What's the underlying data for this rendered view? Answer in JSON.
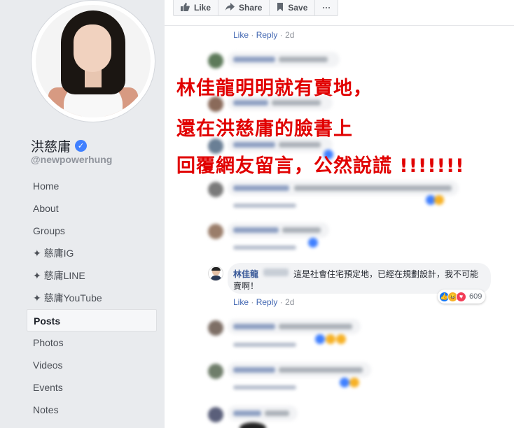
{
  "sidebar": {
    "page_name": "洪慈庸",
    "handle": "@newpowerhung",
    "items": [
      {
        "label": "Home",
        "active": false
      },
      {
        "label": "About",
        "active": false
      },
      {
        "label": "Groups",
        "active": false
      },
      {
        "label": "✦ 慈庸IG",
        "active": false
      },
      {
        "label": "✦ 慈庸LINE",
        "active": false
      },
      {
        "label": "✦ 慈庸YouTube",
        "active": false
      },
      {
        "label": "Posts",
        "active": true
      },
      {
        "label": "Photos",
        "active": false
      },
      {
        "label": "Videos",
        "active": false
      },
      {
        "label": "Events",
        "active": false
      },
      {
        "label": "Notes",
        "active": false
      }
    ]
  },
  "actions": {
    "like": "Like",
    "share": "Share",
    "save": "Save",
    "more": "···"
  },
  "comment_meta": {
    "like": "Like",
    "sep": "·",
    "reply": "Reply",
    "time": "2d"
  },
  "overlay": {
    "line1": "林佳龍明明就有賣地，",
    "line2": "還在洪慈庸的臉書上",
    "line3": "回覆網友留言，公然說謊 !!!!!!!"
  },
  "featured_comment": {
    "name": "林佳龍",
    "text": "這是社會住宅預定地，已經在規劃設計，我不可能賣啊！",
    "reaction_count": "609",
    "like": "Like",
    "reply": "Reply",
    "time": "2d"
  },
  "colors": {
    "overlay_red": "#e10000",
    "link_blue": "#4267b2",
    "sidebar_bg": "#e9ebee",
    "verified_blue": "#4080ff"
  }
}
